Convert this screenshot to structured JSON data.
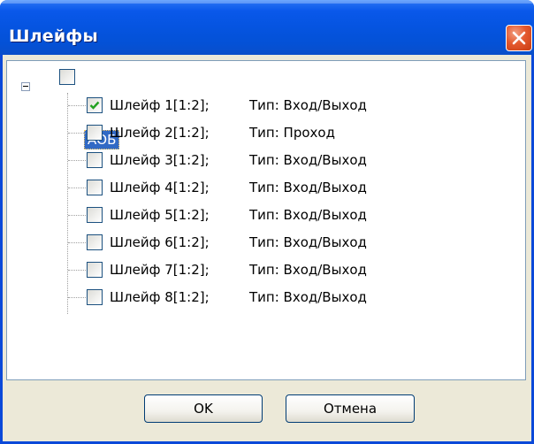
{
  "window": {
    "title": "Шлейфы"
  },
  "tree": {
    "root": {
      "label": "АОБ",
      "checked": false,
      "expanded": true
    },
    "items": [
      {
        "name": "Шлейф 1[1:2];",
        "type": "Тип: Вход/Выход",
        "checked": true
      },
      {
        "name": "Шлейф 2[1:2];",
        "type": "Тип: Проход",
        "checked": false
      },
      {
        "name": "Шлейф 3[1:2];",
        "type": "Тип: Вход/Выход",
        "checked": false
      },
      {
        "name": "Шлейф 4[1:2];",
        "type": "Тип: Вход/Выход",
        "checked": false
      },
      {
        "name": "Шлейф 5[1:2];",
        "type": "Тип: Вход/Выход",
        "checked": false
      },
      {
        "name": "Шлейф 6[1:2];",
        "type": "Тип: Вход/Выход",
        "checked": false
      },
      {
        "name": "Шлейф 7[1:2];",
        "type": "Тип: Вход/Выход",
        "checked": false
      },
      {
        "name": "Шлейф 8[1:2];",
        "type": "Тип: Вход/Выход",
        "checked": false
      }
    ]
  },
  "buttons": {
    "ok_label": "OK",
    "cancel_label": "Отмена"
  },
  "colors": {
    "titlebar": "#0554e0",
    "selection": "#316ac5",
    "check": "#21a121"
  }
}
